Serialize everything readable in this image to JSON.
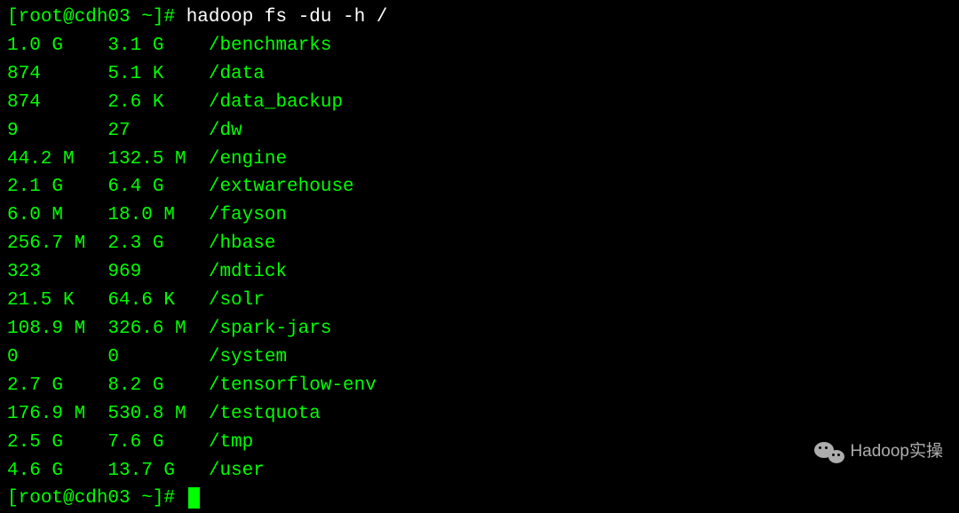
{
  "prompt": {
    "open_bracket": "[",
    "user_host": "root@cdh03",
    "space": " ",
    "path": "~",
    "close_bracket": "]",
    "symbol": "#"
  },
  "command": "hadoop fs -du -h /",
  "rows": [
    {
      "size1": "1.0 G",
      "size2": "3.1 G",
      "path": "/benchmarks"
    },
    {
      "size1": "874",
      "size2": "5.1 K",
      "path": "/data"
    },
    {
      "size1": "874",
      "size2": "2.6 K",
      "path": "/data_backup"
    },
    {
      "size1": "9",
      "size2": "27",
      "path": "/dw"
    },
    {
      "size1": "44.2 M",
      "size2": "132.5 M",
      "path": "/engine"
    },
    {
      "size1": "2.1 G",
      "size2": "6.4 G",
      "path": "/extwarehouse"
    },
    {
      "size1": "6.0 M",
      "size2": "18.0 M",
      "path": "/fayson"
    },
    {
      "size1": "256.7 M",
      "size2": "2.3 G",
      "path": "/hbase"
    },
    {
      "size1": "323",
      "size2": "969",
      "path": "/mdtick"
    },
    {
      "size1": "21.5 K",
      "size2": "64.6 K",
      "path": "/solr"
    },
    {
      "size1": "108.9 M",
      "size2": "326.6 M",
      "path": "/spark-jars"
    },
    {
      "size1": "0",
      "size2": "0",
      "path": "/system"
    },
    {
      "size1": "2.7 G",
      "size2": "8.2 G",
      "path": "/tensorflow-env"
    },
    {
      "size1": "176.9 M",
      "size2": "530.8 M",
      "path": "/testquota"
    },
    {
      "size1": "2.5 G",
      "size2": "7.6 G",
      "path": "/tmp"
    },
    {
      "size1": "4.6 G",
      "size2": "13.7 G",
      "path": "/user"
    }
  ],
  "watermark_text": "Hadoop实操"
}
